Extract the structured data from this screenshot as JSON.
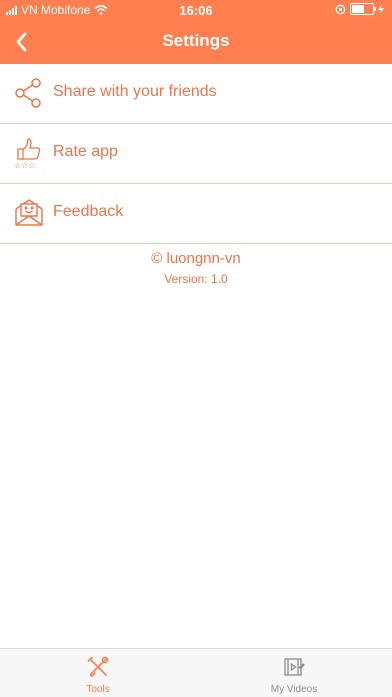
{
  "colors": {
    "accent": "#FF7F50",
    "text_accent": "#F0744A",
    "divider": "#F5C8B0",
    "tab_inactive": "#8E8E93"
  },
  "status_bar": {
    "carrier": "VN Mobifone",
    "time": "16:06"
  },
  "nav": {
    "title": "Settings",
    "back_icon": "chevron-left-icon"
  },
  "menu": {
    "items": [
      {
        "label": "Share with your friends",
        "icon": "share-icon"
      },
      {
        "label": "Rate app",
        "icon": "thumbs-up-stars-icon"
      },
      {
        "label": "Feedback",
        "icon": "envelope-smile-icon"
      }
    ]
  },
  "footer": {
    "copyright": "© luongnn-vn",
    "version": "Version: 1.0"
  },
  "tabbar": {
    "tabs": [
      {
        "label": "Tools",
        "icon": "tools-icon",
        "active": true
      },
      {
        "label": "My Videos",
        "icon": "video-icon",
        "active": false
      }
    ]
  }
}
